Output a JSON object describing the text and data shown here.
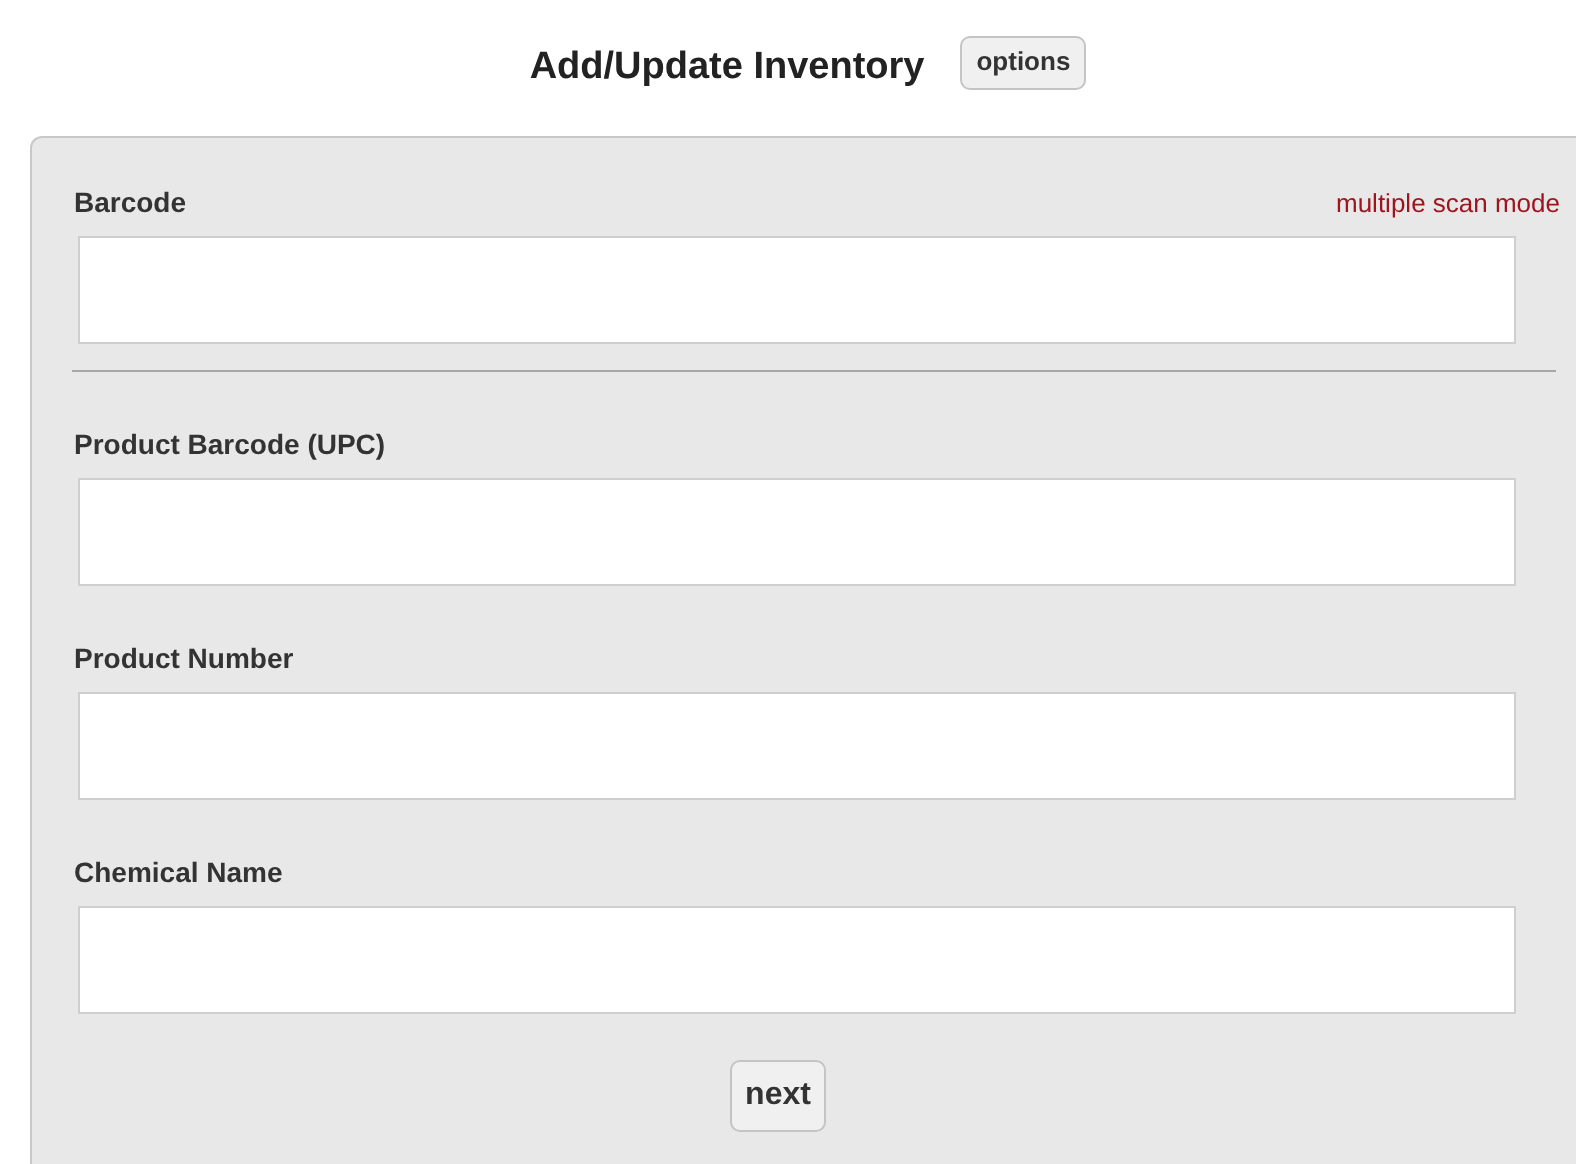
{
  "title": "Add/Update Inventory",
  "options_button": "options",
  "barcode": {
    "label": "Barcode",
    "mode_link": "multiple scan mode"
  },
  "fields": [
    {
      "label": "Product Barcode (UPC)"
    },
    {
      "label": "Product Number"
    },
    {
      "label": "Chemical Name"
    }
  ],
  "next_button": "next"
}
